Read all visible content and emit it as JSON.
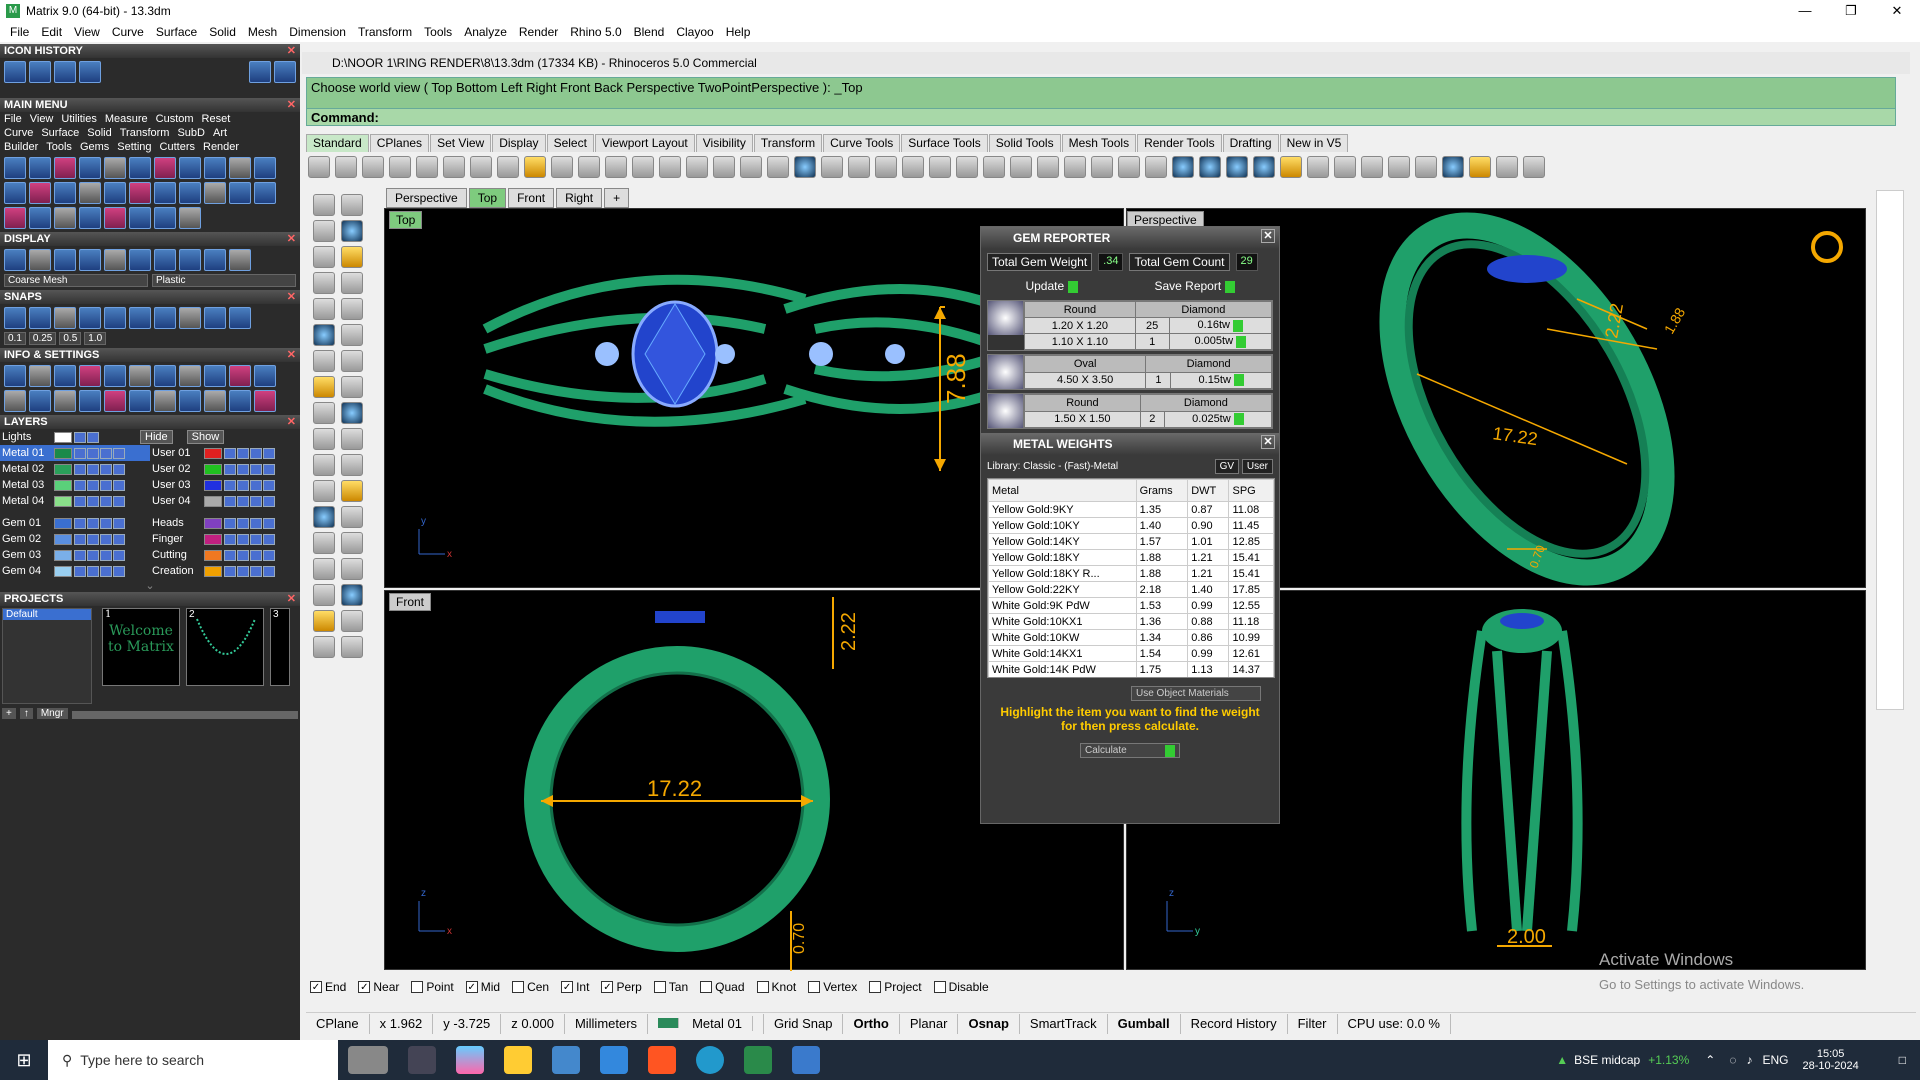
{
  "window": {
    "title": "Matrix 9.0 (64-bit) - 13.3dm"
  },
  "menu": [
    "File",
    "Edit",
    "View",
    "Curve",
    "Surface",
    "Solid",
    "Mesh",
    "Dimension",
    "Transform",
    "Tools",
    "Analyze",
    "Render",
    "Rhino 5.0",
    "Blend",
    "Clayoo",
    "Help"
  ],
  "left": {
    "icon_history": "ICON HISTORY",
    "main_menu": "MAIN MENU",
    "mm_row1": [
      "File",
      "View",
      "Utilities",
      "Measure",
      "Custom",
      "Reset"
    ],
    "mm_row2": [
      "Curve",
      "Surface",
      "Solid",
      "Transform",
      "SubD",
      "Art"
    ],
    "mm_row3": [
      "Builder",
      "Tools",
      "Gems",
      "Setting",
      "Cutters",
      "Render"
    ],
    "display": "DISPLAY",
    "display_mesh": "Coarse Mesh",
    "display_mat": "Plastic",
    "snaps": "SNAPS",
    "snap_vals": [
      "0.1",
      "0.25",
      "0.5",
      "1.0"
    ],
    "info": "INFO & SETTINGS",
    "layers": "LAYERS",
    "lights": "Lights",
    "hide": "Hide",
    "show": "Show",
    "layers_left": [
      "Metal 01",
      "Metal 02",
      "Metal 03",
      "Metal 04",
      "Gem 01",
      "Gem 02",
      "Gem 03",
      "Gem 04"
    ],
    "layers_right": [
      "User 01",
      "User 02",
      "User 03",
      "User 04",
      "Heads",
      "Finger",
      "Cutting",
      "Creation"
    ],
    "projects": "PROJECTS",
    "project_default": "Default",
    "mngr": "Mngr",
    "thumb_text": "Welcome to Matrix",
    "thumb_nums": [
      "1",
      "2",
      "3"
    ]
  },
  "rhino": {
    "title": "D:\\NOOR 1\\RING RENDER\\8\\13.3dm (17334 KB) - Rhinoceros 5.0 Commercial",
    "history": "Choose world view ( Top  Bottom  Left  Right  Front  Back  Perspective  TwoPointPerspective ): _Top",
    "command": "Command:",
    "tabs": [
      "Standard",
      "CPlanes",
      "Set View",
      "Display",
      "Select",
      "Viewport Layout",
      "Visibility",
      "Transform",
      "Curve Tools",
      "Surface Tools",
      "Solid Tools",
      "Mesh Tools",
      "Render Tools",
      "Drafting",
      "New in V5"
    ],
    "vp_tabs": [
      "Perspective",
      "Top",
      "Front",
      "Right",
      "+"
    ]
  },
  "viewports": {
    "top": "Top",
    "perspective": "Perspective",
    "front": "Front",
    "dims": {
      "top_h": "7.88",
      "persp_a": "2.22",
      "persp_b": "1.88",
      "persp_c": "17.22",
      "persp_d": "0.70",
      "front_h": "2.22",
      "front_w": "17.22",
      "front_b": "0.70",
      "right_w": "2.00"
    }
  },
  "gem": {
    "title": "GEM REPORTER",
    "weight_label": "Total Gem Weight",
    "weight": ".34",
    "count_label": "Total Gem Count",
    "count": "29",
    "update": "Update",
    "save": "Save Report",
    "rows": [
      {
        "shape": "Round",
        "type": "Diamond",
        "size": "1.20 X 1.20",
        "qty": "25",
        "wt": "0.16tw"
      },
      {
        "shape": "",
        "type": "",
        "size": "1.10 X 1.10",
        "qty": "1",
        "wt": "0.005tw"
      },
      {
        "shape": "Oval",
        "type": "Diamond",
        "size": "4.50 X 3.50",
        "qty": "1",
        "wt": "0.15tw"
      },
      {
        "shape": "Round",
        "type": "Diamond",
        "size": "1.50 X 1.50",
        "qty": "2",
        "wt": "0.025tw"
      }
    ]
  },
  "metal": {
    "title": "METAL WEIGHTS",
    "library": "Library: Classic - (Fast)-Metal",
    "gv": "GV",
    "user": "User",
    "headers": [
      "Metal",
      "Grams",
      "DWT",
      "SPG"
    ],
    "rows": [
      [
        "Yellow Gold:9KY",
        "1.35",
        "0.87",
        "11.08"
      ],
      [
        "Yellow Gold:10KY",
        "1.40",
        "0.90",
        "11.45"
      ],
      [
        "Yellow Gold:14KY",
        "1.57",
        "1.01",
        "12.85"
      ],
      [
        "Yellow Gold:18KY",
        "1.88",
        "1.21",
        "15.41"
      ],
      [
        "Yellow Gold:18KY R...",
        "1.88",
        "1.21",
        "15.41"
      ],
      [
        "Yellow Gold:22KY",
        "2.18",
        "1.40",
        "17.85"
      ],
      [
        "White Gold:9K PdW",
        "1.53",
        "0.99",
        "12.55"
      ],
      [
        "White Gold:10KX1",
        "1.36",
        "0.88",
        "11.18"
      ],
      [
        "White Gold:10KW",
        "1.34",
        "0.86",
        "10.99"
      ],
      [
        "White Gold:14KX1",
        "1.54",
        "0.99",
        "12.61"
      ],
      [
        "White Gold:14K PdW",
        "1.75",
        "1.13",
        "14.37"
      ]
    ],
    "use_obj": "Use Object Materials",
    "hint": "Highlight the item you want to find the weight for then press calculate.",
    "calc": "Calculate"
  },
  "snapbar": [
    {
      "l": "End",
      "c": true
    },
    {
      "l": "Near",
      "c": true
    },
    {
      "l": "Point",
      "c": false
    },
    {
      "l": "Mid",
      "c": true
    },
    {
      "l": "Cen",
      "c": false
    },
    {
      "l": "Int",
      "c": true
    },
    {
      "l": "Perp",
      "c": true
    },
    {
      "l": "Tan",
      "c": false
    },
    {
      "l": "Quad",
      "c": false
    },
    {
      "l": "Knot",
      "c": false
    },
    {
      "l": "Vertex",
      "c": false
    },
    {
      "l": "Project",
      "c": false
    },
    {
      "l": "Disable",
      "c": false
    }
  ],
  "status": {
    "cplane": "CPlane",
    "x": "x 1.962",
    "y": "y -3.725",
    "z": "z 0.000",
    "units": "Millimeters",
    "layer": "Metal 01",
    "items": [
      "Grid Snap",
      "Ortho",
      "Planar",
      "Osnap",
      "SmartTrack",
      "Gumball",
      "Record History",
      "Filter",
      "CPU use: 0.0 %"
    ]
  },
  "activate": {
    "title": "Activate Windows",
    "sub": "Go to Settings to activate Windows."
  },
  "taskbar": {
    "search": "Type here to search",
    "ticker": "BSE midcap",
    "change": "+1.13%",
    "lang": "ENG",
    "time": "15:05",
    "date": "28-10-2024"
  },
  "colors": {
    "ring": "#1c8a5a",
    "gold": "#f5a800",
    "gem": "#2244cc"
  }
}
